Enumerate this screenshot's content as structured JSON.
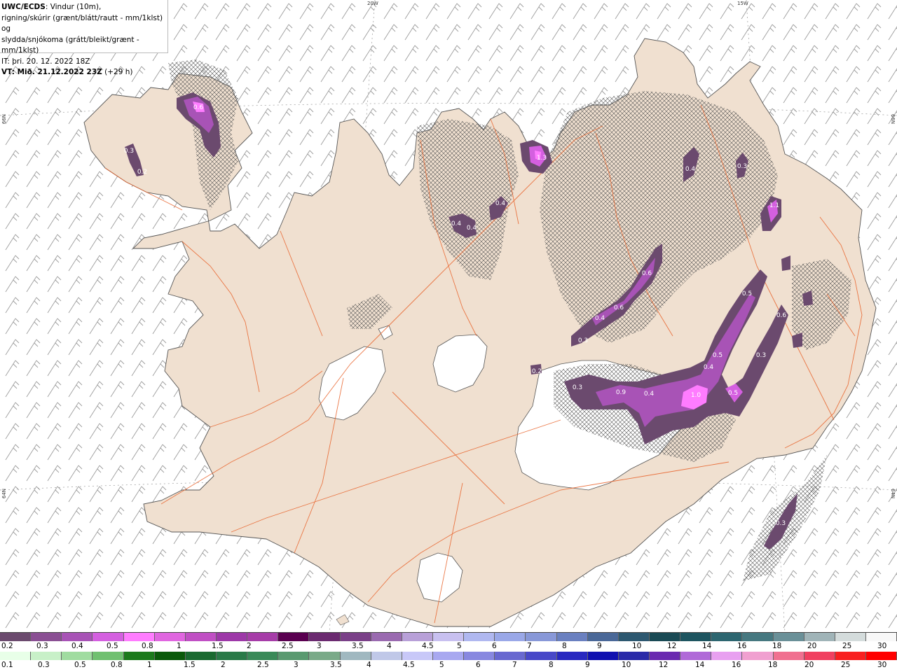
{
  "header": {
    "product": "UWC/ECDS",
    "description_1": ": Vindur (10m),",
    "description_2": "rigning/skúrir (grænt/blátt/rautt - mm/1klst) og",
    "description_3": "slydda/snjókoma (grátt/bleikt/grænt - mm/1klst)",
    "init_time": "IT: þri. 20. 12. 2022 18Z",
    "valid_prefix": "VT: Mið. 21.12.2022 23Z",
    "valid_suffix": " (+29 h)"
  },
  "grid_labels": {
    "lon_20w": "20W",
    "lon_15w": "15W",
    "lat_66n_left": "66N",
    "lat_66n_right": "66N",
    "lat_64n_left": "64N",
    "lat_64n_right": "64N"
  },
  "colors": {
    "land": "#f0e0d0",
    "roads": "#e8622a",
    "glacier": "#ffffff",
    "wind_barbs": "#888888",
    "snow_heavy": "#8a3c9c",
    "snow_light": "#6b4a6e"
  },
  "precip_labels": [
    {
      "text": "0.6",
      "region": "westfjords"
    },
    {
      "text": "0.3",
      "region": "westfjords"
    },
    {
      "text": "0.2",
      "region": "westfjords"
    },
    {
      "text": "1.3",
      "region": "north"
    },
    {
      "text": "0.4",
      "region": "north"
    },
    {
      "text": "0.4",
      "region": "north"
    },
    {
      "text": "0.4",
      "region": "north"
    },
    {
      "text": "0.4",
      "region": "northeast"
    },
    {
      "text": "0.3",
      "region": "northeast"
    },
    {
      "text": "1.1",
      "region": "east"
    },
    {
      "text": "0.6",
      "region": "central"
    },
    {
      "text": "0.6",
      "region": "central"
    },
    {
      "text": "0.4",
      "region": "central"
    },
    {
      "text": "0.3",
      "region": "central"
    },
    {
      "text": "0.5",
      "region": "east"
    },
    {
      "text": "0.6",
      "region": "east"
    },
    {
      "text": "0.3",
      "region": "east"
    },
    {
      "text": "0.5",
      "region": "east"
    },
    {
      "text": "0.4",
      "region": "east"
    },
    {
      "text": "0.3",
      "region": "vatnajokull"
    },
    {
      "text": "0.9",
      "region": "vatnajokull"
    },
    {
      "text": "0.4",
      "region": "vatnajokull"
    },
    {
      "text": "0.5",
      "region": "vatnajokull"
    },
    {
      "text": "1.0",
      "region": "vatnajokull"
    },
    {
      "text": "0.2",
      "region": "central"
    },
    {
      "text": "0.3",
      "region": "offshore"
    }
  ],
  "legend_snow": {
    "colors": [
      "#6b4a6e",
      "#8a4f93",
      "#a853b6",
      "#d45fe0",
      "#ff7cff",
      "#e066e0",
      "#c04fc4",
      "#9d38a8",
      "#a63ca8",
      "#5a0050",
      "#6b2a70",
      "#7a4088",
      "#9a6ab0",
      "#b8a0d8",
      "#c8c0f0",
      "#b0b8f0",
      "#9aa8e8",
      "#8898d8",
      "#6a80c0",
      "#4a6898",
      "#2d5870",
      "#1a4a55",
      "#1e5560",
      "#2d6670",
      "#467880",
      "#6a9098",
      "#a0b4b8",
      "#d4dcdc",
      "#f8f8f8"
    ],
    "labels": [
      "0.2",
      "0.3",
      "0.4",
      "0.5",
      "0.8",
      "1",
      "1.5",
      "2",
      "2.5",
      "3",
      "3.5",
      "4",
      "4.5",
      "5",
      "6",
      "7",
      "8",
      "9",
      "10",
      "12",
      "14",
      "16",
      "18",
      "20",
      "25",
      "30"
    ]
  },
  "legend_rain": {
    "colors": [
      "#e8ffe8",
      "#c8f0c8",
      "#a0dca0",
      "#70c070",
      "#1c7a1c",
      "#0a5a0a",
      "#1a6a30",
      "#2a7a48",
      "#3a8a58",
      "#5a9a70",
      "#7aaa88",
      "#a0b8c0",
      "#c0c8e8",
      "#c8c8f8",
      "#a8a8f0",
      "#8888e0",
      "#6868d0",
      "#4848c8",
      "#2828c0",
      "#1010b0",
      "#2a2aa8",
      "#6a2ab0",
      "#b06ad8",
      "#e8a0f0",
      "#f0a0d0",
      "#f07090",
      "#f04060",
      "#f82020",
      "#ff0000"
    ],
    "labels": [
      "0.1",
      "0.3",
      "0.5",
      "0.8",
      "1",
      "1.5",
      "2",
      "2.5",
      "3",
      "3.5",
      "4",
      "4.5",
      "5",
      "6",
      "7",
      "8",
      "9",
      "10",
      "12",
      "14",
      "16",
      "18",
      "20",
      "25",
      "30"
    ]
  }
}
